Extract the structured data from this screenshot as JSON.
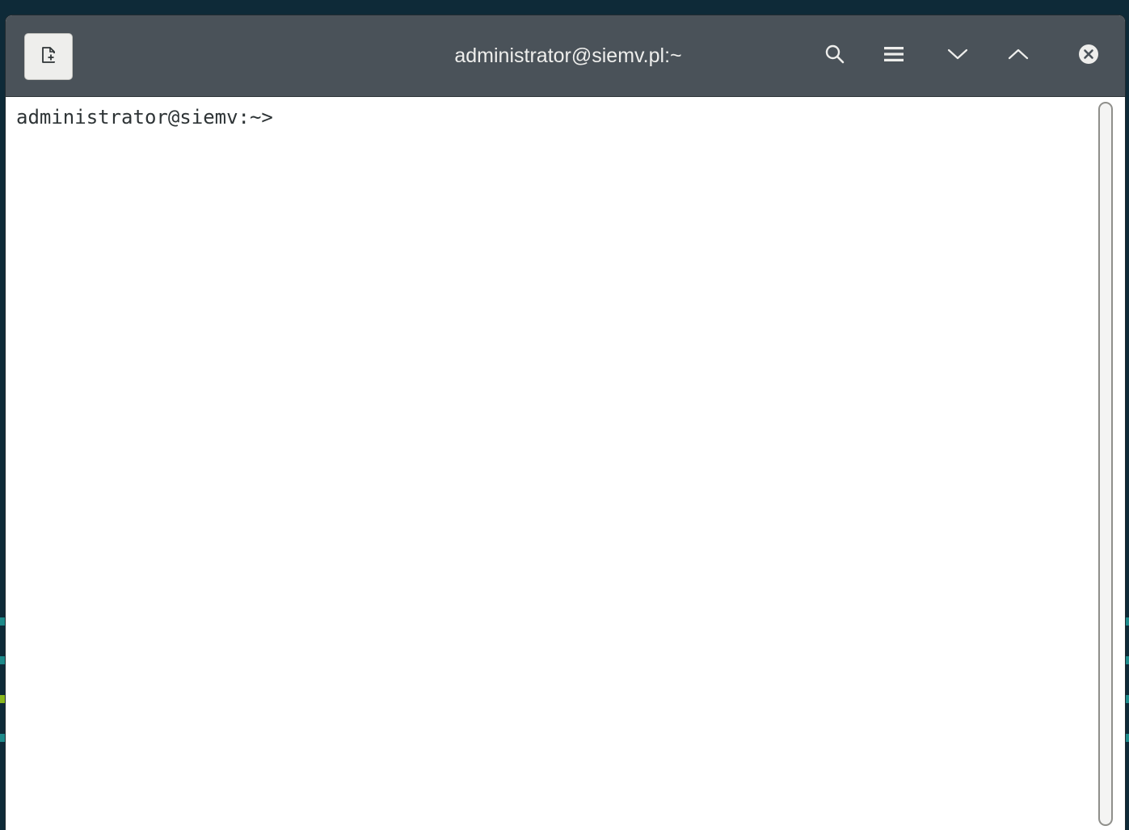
{
  "window": {
    "title": "administrator@siemv.pl:~"
  },
  "headerbar": {
    "icons": [
      "new-tab-icon",
      "search-icon",
      "hamburger-menu-icon",
      "minimize-icon",
      "maximize-icon",
      "close-icon"
    ]
  },
  "terminal": {
    "prompt": "administrator@siemv:~>"
  },
  "colors": {
    "headerbar": "#4a5259",
    "title_text": "#eeeeec",
    "terminal_bg": "#ffffff",
    "terminal_text": "#2e3436",
    "desktop_bg": "#0e2a38"
  }
}
